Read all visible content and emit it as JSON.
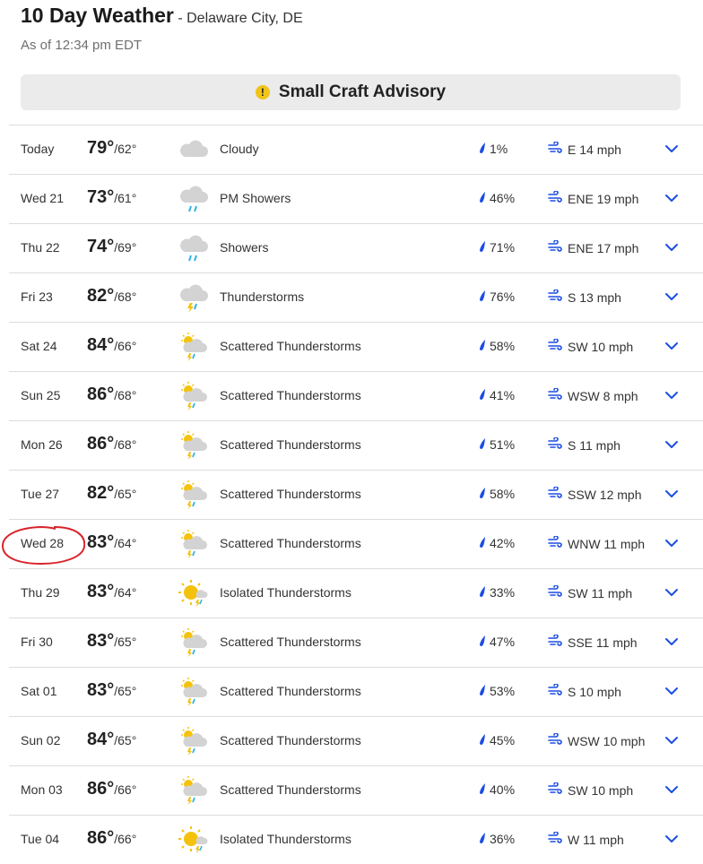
{
  "header": {
    "title": "10 Day Weather",
    "location": "- Delaware City, DE",
    "as_of": "As of 12:34 pm EDT"
  },
  "advisory": {
    "icon": "alert-icon",
    "icon_glyph": "!",
    "label": "Small Craft Advisory"
  },
  "colors": {
    "accent": "#1b4de4",
    "advisory_icon": "#f0c419",
    "annotation": "#d9232a"
  },
  "days": [
    {
      "day": "Today",
      "hi": "79°",
      "lo": "/62°",
      "icon": "cloudy",
      "condition": "Cloudy",
      "precip": "1%",
      "wind": "E 14 mph"
    },
    {
      "day": "Wed 21",
      "hi": "73°",
      "lo": "/61°",
      "icon": "showers",
      "condition": "PM Showers",
      "precip": "46%",
      "wind": "ENE 19 mph"
    },
    {
      "day": "Thu 22",
      "hi": "74°",
      "lo": "/69°",
      "icon": "showers",
      "condition": "Showers",
      "precip": "71%",
      "wind": "ENE 17 mph"
    },
    {
      "day": "Fri 23",
      "hi": "82°",
      "lo": "/68°",
      "icon": "thunderstorms",
      "condition": "Thunderstorms",
      "precip": "76%",
      "wind": "S 13 mph"
    },
    {
      "day": "Sat 24",
      "hi": "84°",
      "lo": "/66°",
      "icon": "scattered-storms",
      "condition": "Scattered Thunderstorms",
      "precip": "58%",
      "wind": "SW 10 mph"
    },
    {
      "day": "Sun 25",
      "hi": "86°",
      "lo": "/68°",
      "icon": "scattered-storms",
      "condition": "Scattered Thunderstorms",
      "precip": "41%",
      "wind": "WSW 8 mph"
    },
    {
      "day": "Mon 26",
      "hi": "86°",
      "lo": "/68°",
      "icon": "scattered-storms",
      "condition": "Scattered Thunderstorms",
      "precip": "51%",
      "wind": "S 11 mph"
    },
    {
      "day": "Tue 27",
      "hi": "82°",
      "lo": "/65°",
      "icon": "scattered-storms",
      "condition": "Scattered Thunderstorms",
      "precip": "58%",
      "wind": "SSW 12 mph"
    },
    {
      "day": "Wed 28",
      "hi": "83°",
      "lo": "/64°",
      "icon": "scattered-storms",
      "condition": "Scattered Thunderstorms",
      "precip": "42%",
      "wind": "WNW 11 mph"
    },
    {
      "day": "Thu 29",
      "hi": "83°",
      "lo": "/64°",
      "icon": "isolated-storms",
      "condition": "Isolated Thunderstorms",
      "precip": "33%",
      "wind": "SW 11 mph"
    },
    {
      "day": "Fri 30",
      "hi": "83°",
      "lo": "/65°",
      "icon": "scattered-storms",
      "condition": "Scattered Thunderstorms",
      "precip": "47%",
      "wind": "SSE 11 mph"
    },
    {
      "day": "Sat 01",
      "hi": "83°",
      "lo": "/65°",
      "icon": "scattered-storms",
      "condition": "Scattered Thunderstorms",
      "precip": "53%",
      "wind": "S 10 mph"
    },
    {
      "day": "Sun 02",
      "hi": "84°",
      "lo": "/65°",
      "icon": "scattered-storms",
      "condition": "Scattered Thunderstorms",
      "precip": "45%",
      "wind": "WSW 10 mph"
    },
    {
      "day": "Mon 03",
      "hi": "86°",
      "lo": "/66°",
      "icon": "scattered-storms",
      "condition": "Scattered Thunderstorms",
      "precip": "40%",
      "wind": "SW 10 mph"
    },
    {
      "day": "Tue 04",
      "hi": "86°",
      "lo": "/66°",
      "icon": "isolated-storms",
      "condition": "Isolated Thunderstorms",
      "precip": "36%",
      "wind": "W 11 mph"
    }
  ]
}
